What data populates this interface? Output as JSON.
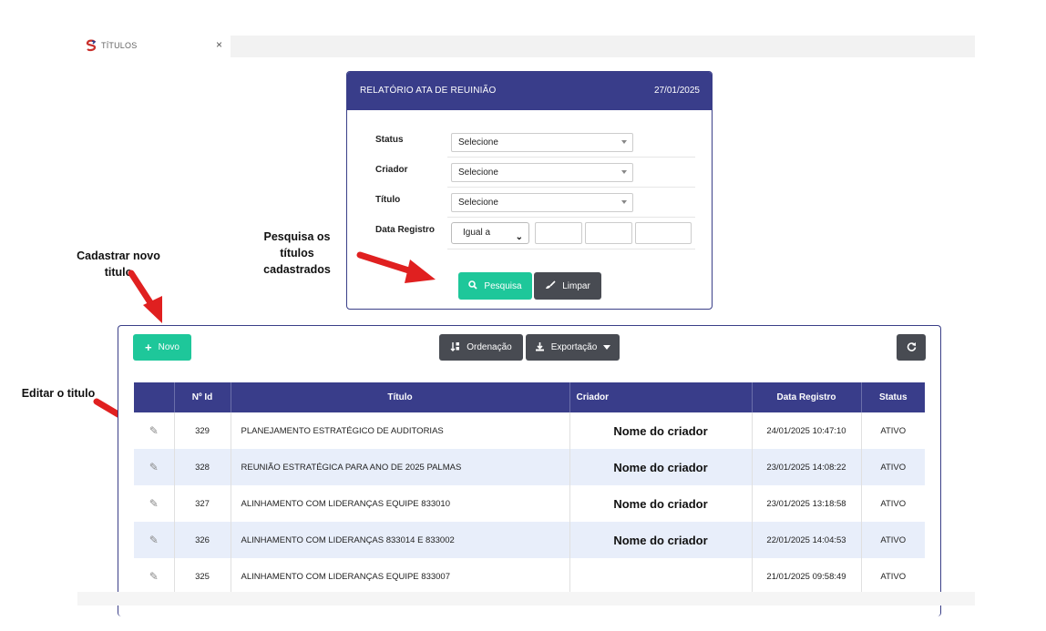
{
  "tab": {
    "title": "TÍTULOS",
    "close": "×"
  },
  "filter_panel": {
    "title": "RELATÓRIO ATA DE REUINIÃO",
    "date": "27/01/2025",
    "fields": [
      {
        "label": "Status",
        "value": "Selecione"
      },
      {
        "label": "Criador",
        "value": "Selecione"
      },
      {
        "label": "Título",
        "value": "Selecione"
      }
    ],
    "date_field": {
      "label": "Data Registro",
      "operator": "Igual a"
    },
    "search_button": "Pesquisa",
    "clear_button": "Limpar"
  },
  "annotations": {
    "search": "Pesquisa os títulos cadastrados",
    "new": "Cadastrar novo titulo",
    "edit": "Editar o titulo"
  },
  "toolbar": {
    "new_button": "Novo",
    "sort_button": "Ordenação",
    "export_button": "Exportação"
  },
  "table": {
    "headers": [
      "",
      "Nº Id",
      "Título",
      "Criador",
      "Data Registro",
      "Status"
    ],
    "rows": [
      {
        "id": "329",
        "title": "PLANEJAMENTO ESTRATÉGICO DE AUDITORIAS",
        "creator": "Nome do criador",
        "date": "24/01/2025 10:47:10",
        "status": "ATIVO"
      },
      {
        "id": "328",
        "title": "REUNIÃO ESTRATÉGICA PARA ANO DE 2025 PALMAS",
        "creator": "Nome do criador",
        "date": "23/01/2025 14:08:22",
        "status": "ATIVO"
      },
      {
        "id": "327",
        "title": "ALINHAMENTO COM LIDERANÇAS EQUIPE 833010",
        "creator": "Nome do criador",
        "date": "23/01/2025 13:18:58",
        "status": "ATIVO"
      },
      {
        "id": "326",
        "title": "ALINHAMENTO COM LIDERANÇAS 833014 E 833002",
        "creator": "Nome do criador",
        "date": "22/01/2025 14:04:53",
        "status": "ATIVO"
      },
      {
        "id": "325",
        "title": "ALINHAMENTO COM LIDERANÇAS EQUIPE 833007",
        "creator": "",
        "date": "21/01/2025 09:58:49",
        "status": "ATIVO"
      }
    ]
  },
  "colors": {
    "header": "#393d8a",
    "accent": "#1ec79a",
    "dark_button": "#484b52",
    "row_alt": "#e8eefa",
    "arrow": "#e02020"
  }
}
